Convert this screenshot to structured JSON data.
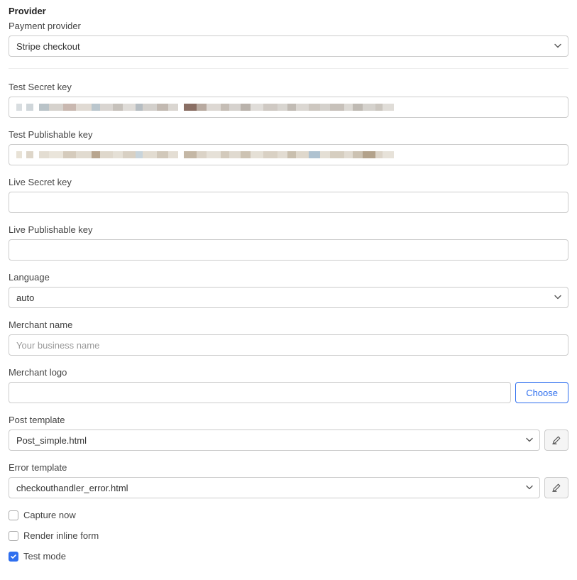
{
  "section_header": "Provider",
  "provider": {
    "label": "Payment provider",
    "value": "Stripe checkout"
  },
  "test_secret": {
    "label": "Test Secret key"
  },
  "test_publishable": {
    "label": "Test Publishable key"
  },
  "live_secret": {
    "label": "Live Secret key",
    "value": ""
  },
  "live_publishable": {
    "label": "Live Publishable key",
    "value": ""
  },
  "language": {
    "label": "Language",
    "value": "auto"
  },
  "merchant_name": {
    "label": "Merchant name",
    "placeholder": "Your business name",
    "value": ""
  },
  "merchant_logo": {
    "label": "Merchant logo",
    "value": "",
    "choose_label": "Choose"
  },
  "post_template": {
    "label": "Post template",
    "value": "Post_simple.html"
  },
  "error_template": {
    "label": "Error template",
    "value": "checkouthandler_error.html"
  },
  "capture_now": {
    "label": "Capture now",
    "checked": false
  },
  "render_inline": {
    "label": "Render inline form",
    "checked": false
  },
  "test_mode": {
    "label": "Test mode",
    "checked": true
  }
}
